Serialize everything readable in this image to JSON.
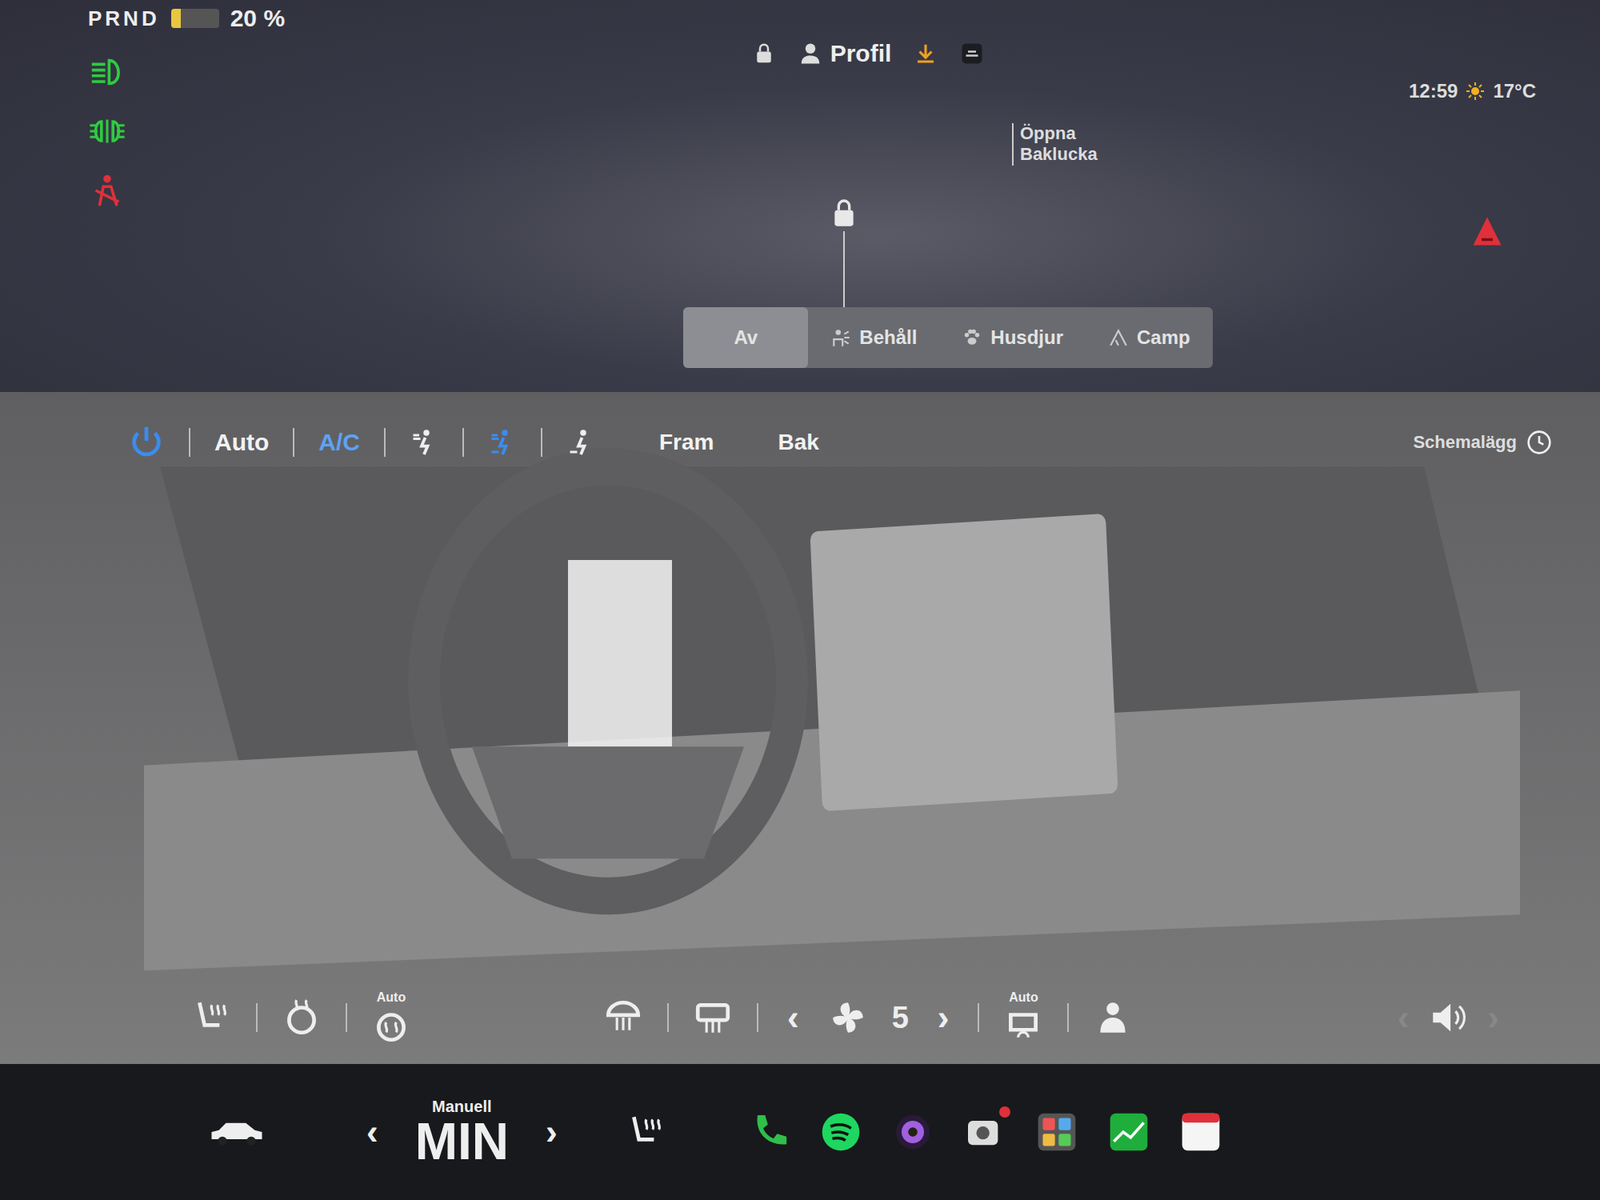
{
  "status": {
    "gear": "PRND",
    "battery": "20 %",
    "battery_level": 0.2,
    "time": "12:59",
    "temperature": "17°C"
  },
  "indicators": [
    {
      "kind": "headlights",
      "color": "#2ecc40"
    },
    {
      "kind": "fog-lights",
      "color": "#2ecc40"
    },
    {
      "kind": "seatbelt-warning",
      "color": "#e0303a"
    }
  ],
  "header": {
    "profile": "Profil",
    "locked": true
  },
  "car": {
    "locked": true,
    "trunk": "Öppna Baklucka"
  },
  "modes": [
    {
      "label": "Av",
      "kind": "none",
      "selected": true
    },
    {
      "label": "Behåll",
      "kind": "keep",
      "selected": false
    },
    {
      "label": "Husdjur",
      "kind": "pet",
      "selected": false
    },
    {
      "label": "Camp",
      "kind": "camp",
      "selected": false
    }
  ],
  "climate": {
    "power_on": true,
    "auto": {
      "label": "Auto",
      "on": false
    },
    "ac": {
      "label": "A/C",
      "on": true
    },
    "airflow": [
      {
        "kind": "face",
        "selected": false
      },
      {
        "kind": "face-feet",
        "selected": true
      },
      {
        "kind": "feet",
        "selected": false
      }
    ],
    "zones": [
      {
        "label": "Fram",
        "selected": false
      },
      {
        "label": "Bak",
        "selected": false
      }
    ],
    "schedule": "Schemalägg"
  },
  "controls": {
    "seat_auto": "Auto",
    "fan": {
      "prev": "‹",
      "value": "5",
      "next": "›"
    },
    "recirc": "Auto",
    "volume": {
      "prev": "‹",
      "next": "›"
    }
  },
  "dock": {
    "temp": {
      "prev": "‹",
      "mode": "Manuell",
      "value": "MIN",
      "next": "›"
    },
    "apps": [
      {
        "kind": "phone",
        "badge": false
      },
      {
        "kind": "spotify",
        "badge": false
      },
      {
        "kind": "camera",
        "badge": false
      },
      {
        "kind": "dashcam",
        "badge": true
      },
      {
        "kind": "apps",
        "badge": false
      },
      {
        "kind": "stocks",
        "badge": false
      },
      {
        "kind": "calendar",
        "badge": false
      }
    ]
  }
}
